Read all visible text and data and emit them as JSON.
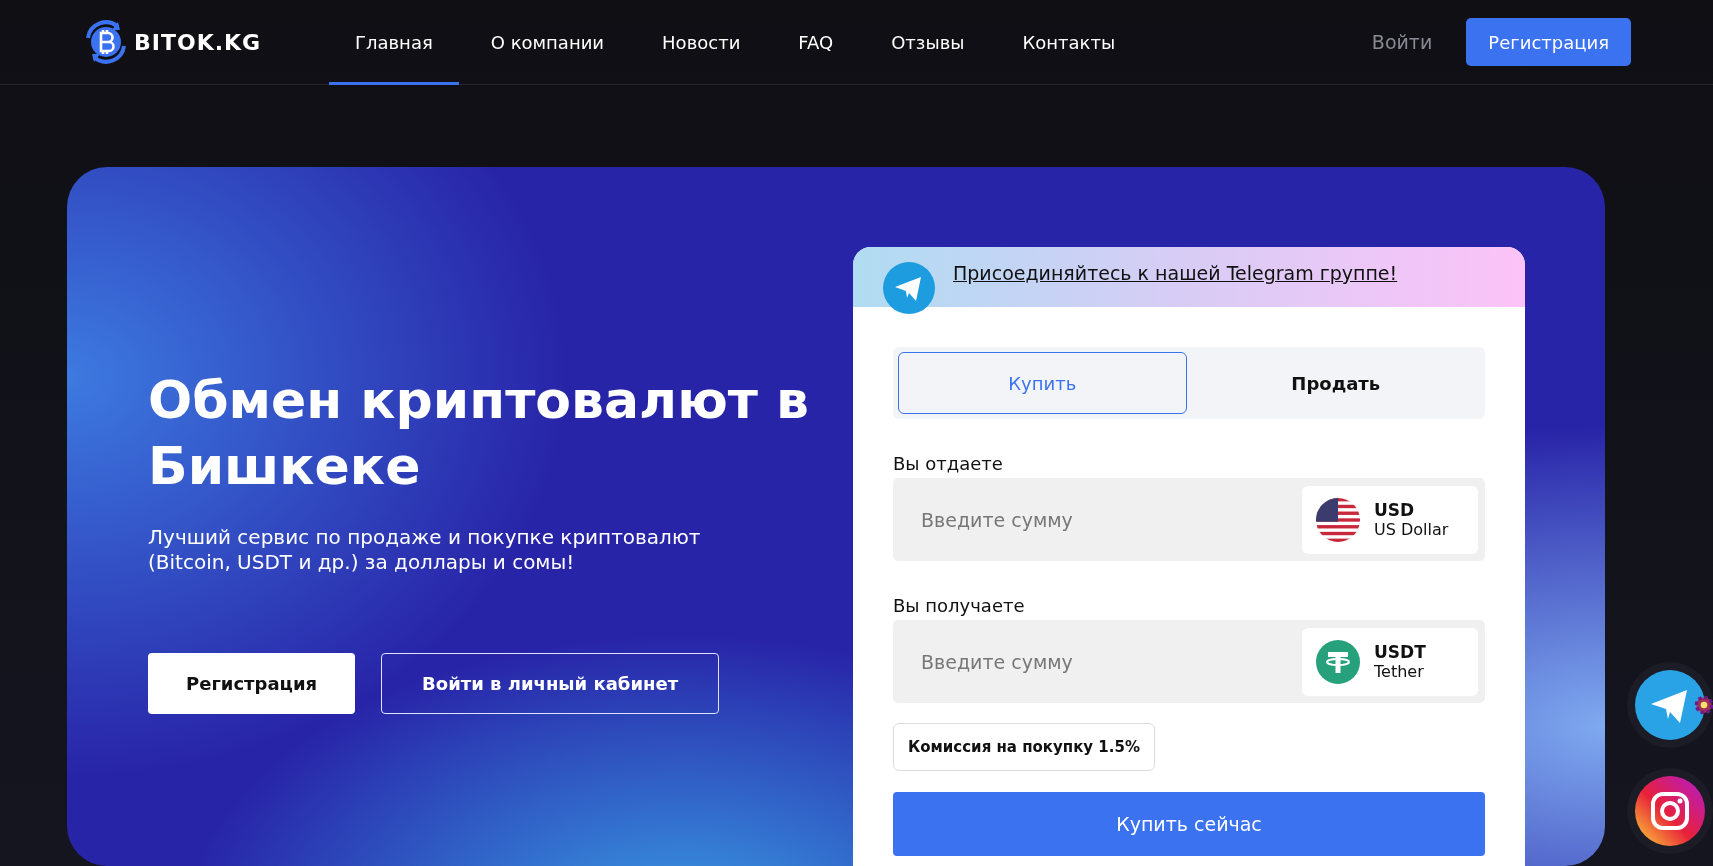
{
  "header": {
    "logo_text": "BITOK.KG",
    "nav": [
      {
        "label": "Главная",
        "selected": true
      },
      {
        "label": "О компании",
        "selected": false
      },
      {
        "label": "Новости",
        "selected": false
      },
      {
        "label": "FAQ",
        "selected": false
      },
      {
        "label": "Отзывы",
        "selected": false
      },
      {
        "label": "Контакты",
        "selected": false
      }
    ],
    "login": "Войти",
    "register": "Регистрация"
  },
  "hero": {
    "title": "Обмен криптовалют в Бишкеке",
    "subtitle": "Лучший сервис по продаже и покупке криптовалют (Bitcoin, USDT и др.) за доллары и сомы!",
    "buttons": [
      {
        "label": "Регистрация",
        "kind": "solid"
      },
      {
        "label": "Войти в личный кабинет",
        "kind": "outline"
      }
    ]
  },
  "exchange": {
    "banner": "Присоединяйтесь к нашей Telegram группе!",
    "tabs": [
      {
        "label": "Купить",
        "selected": true
      },
      {
        "label": "Продать",
        "selected": false
      }
    ],
    "fields": [
      {
        "label": "Вы отдаете",
        "placeholder": "Введите сумму",
        "code": "USD",
        "name": "US Dollar",
        "kind": "usd"
      },
      {
        "label": "Вы получаете",
        "placeholder": "Введите сумму",
        "code": "USDT",
        "name": "Tether",
        "kind": "tether"
      }
    ],
    "commission": "Комиссия на покупку 1.5%",
    "submit": "Купить сейчас"
  },
  "floating": [
    {
      "kind": "telegram"
    },
    {
      "kind": "instagram"
    }
  ]
}
